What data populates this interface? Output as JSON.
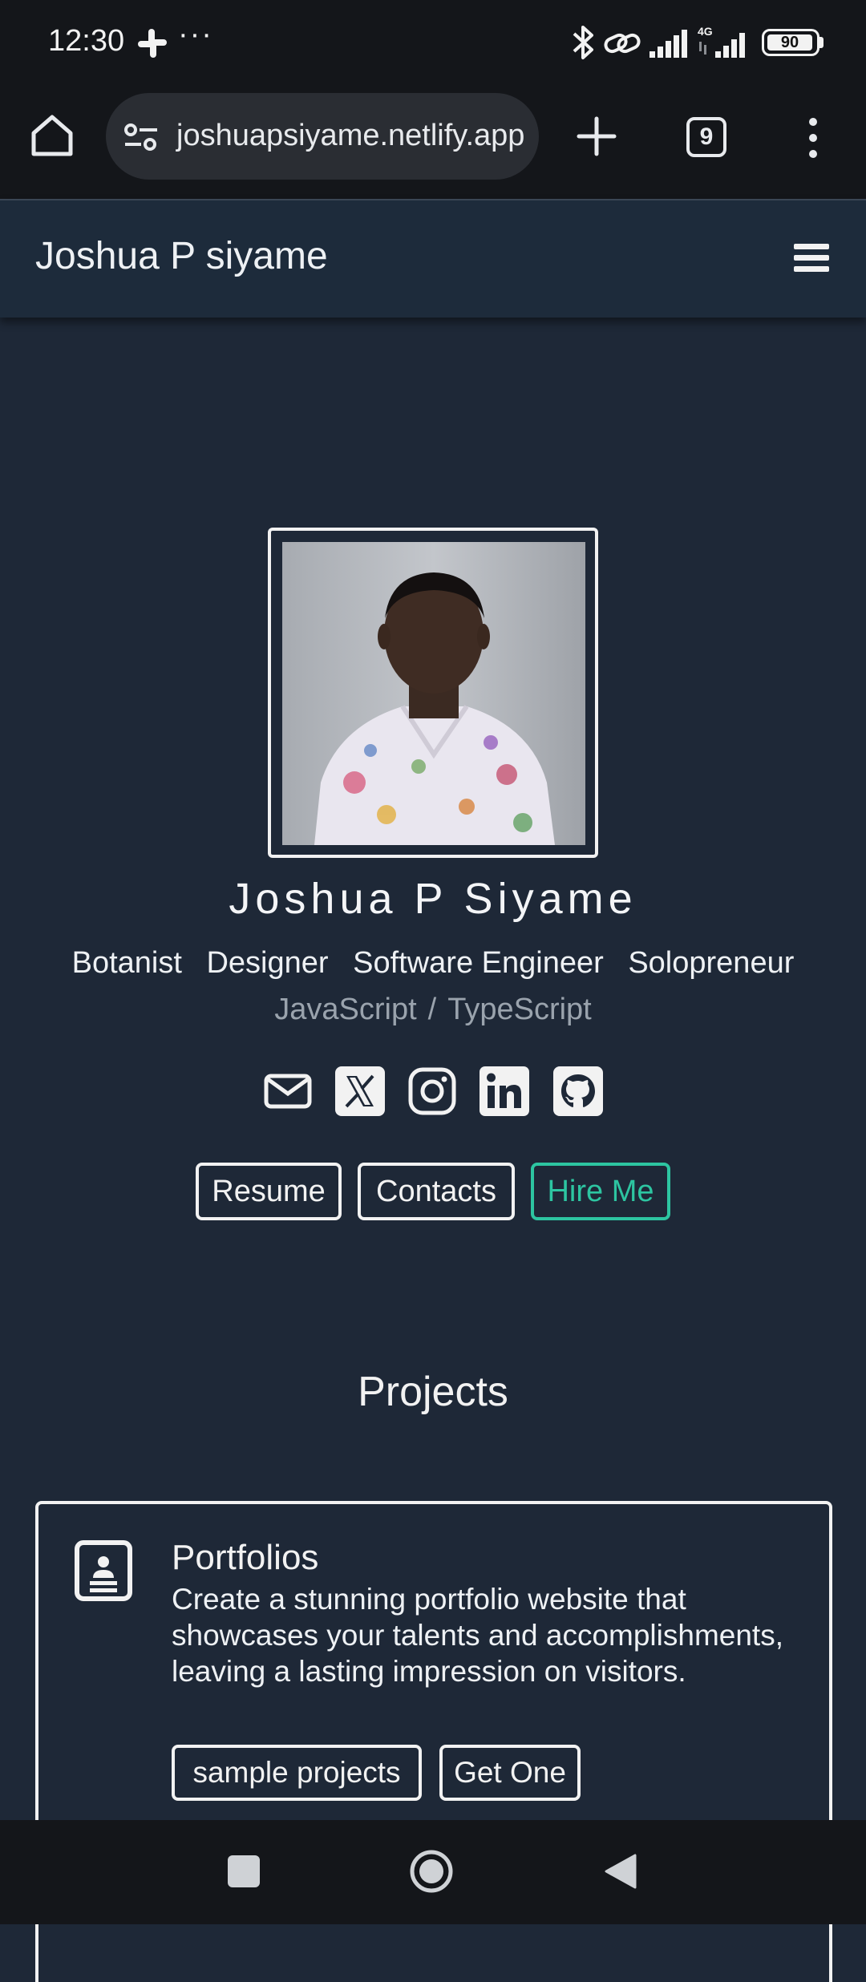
{
  "status_bar": {
    "time": "12:30",
    "more": "···",
    "battery": "90",
    "icons": [
      "slack-icon",
      "bluetooth-icon",
      "link-icon",
      "signal-icon",
      "4g-signal-icon",
      "battery-icon"
    ]
  },
  "browser": {
    "url": "joshuapsiyame.netlify.app",
    "tab_count": "9",
    "icons": [
      "home-icon",
      "site-settings-icon",
      "plus-icon",
      "more-vert-icon"
    ]
  },
  "site": {
    "title": "Joshua P siyame"
  },
  "profile": {
    "name": "Joshua P Siyame",
    "roles": [
      "Botanist",
      "Designer",
      "Software Engineer",
      "Solopreneur"
    ],
    "languages": [
      "JavaScript",
      "TypeScript"
    ],
    "language_separator": "/",
    "social_icons": [
      "mail-icon",
      "x-icon",
      "instagram-icon",
      "linkedin-icon",
      "github-icon"
    ],
    "buttons": {
      "resume": "Resume",
      "contacts": "Contacts",
      "hire": "Hire Me"
    }
  },
  "projects": {
    "heading": "Projects",
    "items": [
      {
        "title": "Portfolios",
        "description": "Create a stunning portfolio website that showcases your talents and accomplishments, leaving a lasting impression on visitors.",
        "buttons": [
          "sample projects",
          "Get One"
        ]
      }
    ]
  },
  "colors": {
    "page_bg": "#1e2837",
    "navbar_bg": "#1d2b3b",
    "system_bar_bg": "#14161a",
    "accent": "#2dc5a1",
    "muted_text": "#9aa3ad"
  }
}
